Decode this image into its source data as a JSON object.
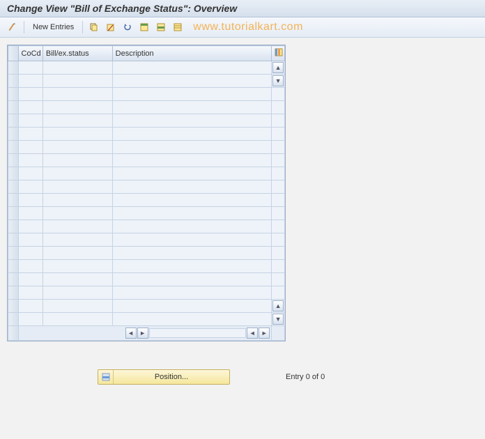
{
  "header": {
    "title": "Change View \"Bill of Exchange Status\": Overview"
  },
  "toolbar": {
    "new_entries_label": "New Entries"
  },
  "watermark": {
    "text": "www.tutorialkart.com"
  },
  "table": {
    "columns": {
      "cocd": "CoCd",
      "status": "Bill/ex.status",
      "description": "Description"
    },
    "rows": [
      {
        "cocd": "",
        "status": "",
        "description": ""
      },
      {
        "cocd": "",
        "status": "",
        "description": ""
      },
      {
        "cocd": "",
        "status": "",
        "description": ""
      },
      {
        "cocd": "",
        "status": "",
        "description": ""
      },
      {
        "cocd": "",
        "status": "",
        "description": ""
      },
      {
        "cocd": "",
        "status": "",
        "description": ""
      },
      {
        "cocd": "",
        "status": "",
        "description": ""
      },
      {
        "cocd": "",
        "status": "",
        "description": ""
      },
      {
        "cocd": "",
        "status": "",
        "description": ""
      },
      {
        "cocd": "",
        "status": "",
        "description": ""
      },
      {
        "cocd": "",
        "status": "",
        "description": ""
      },
      {
        "cocd": "",
        "status": "",
        "description": ""
      },
      {
        "cocd": "",
        "status": "",
        "description": ""
      },
      {
        "cocd": "",
        "status": "",
        "description": ""
      },
      {
        "cocd": "",
        "status": "",
        "description": ""
      },
      {
        "cocd": "",
        "status": "",
        "description": ""
      },
      {
        "cocd": "",
        "status": "",
        "description": ""
      },
      {
        "cocd": "",
        "status": "",
        "description": ""
      },
      {
        "cocd": "",
        "status": "",
        "description": ""
      },
      {
        "cocd": "",
        "status": "",
        "description": ""
      }
    ]
  },
  "footer": {
    "position_label": "Position...",
    "entry_text": "Entry 0 of 0"
  }
}
